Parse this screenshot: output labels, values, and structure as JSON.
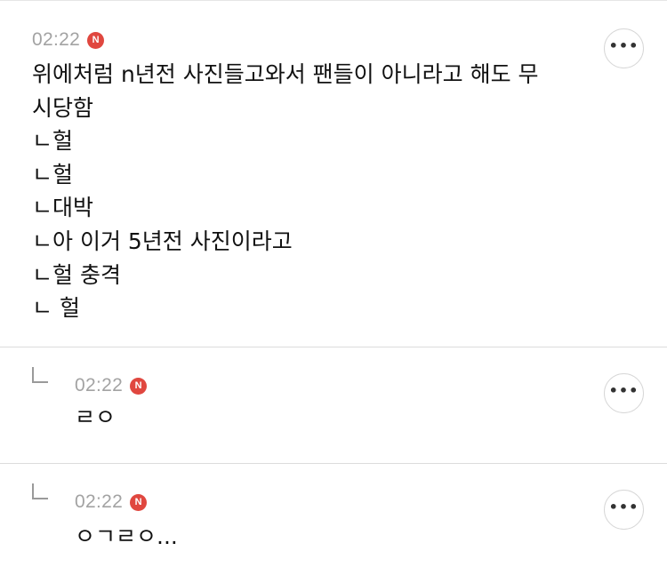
{
  "comments": [
    {
      "time": "02:22",
      "badge": "N",
      "lines": [
        "위에처럼 n년전 사진들고와서 팬들이 아니라고 해도 무",
        "시당함",
        "ㄴ헐",
        "ㄴ헐",
        "ㄴ대박",
        "ㄴ아 이거 5년전 사진이라고",
        "ㄴ헐 충격",
        "ㄴ 헐"
      ],
      "more_icon": "ellipsis-icon",
      "more_label": "•••"
    },
    {
      "time": "02:22",
      "badge": "N",
      "text": "ㄹㅇ",
      "reply_icon": "reply-arrow-icon",
      "more_icon": "ellipsis-icon",
      "more_label": "•••"
    },
    {
      "time": "02:22",
      "badge": "N",
      "text": "ㅇㄱㄹㅇ...",
      "reply_icon": "reply-arrow-icon",
      "more_icon": "ellipsis-icon",
      "more_label": "•••"
    }
  ],
  "colors": {
    "badge": "#e0473f",
    "time": "#a3a3a3",
    "divider": "#dcdcdc"
  }
}
